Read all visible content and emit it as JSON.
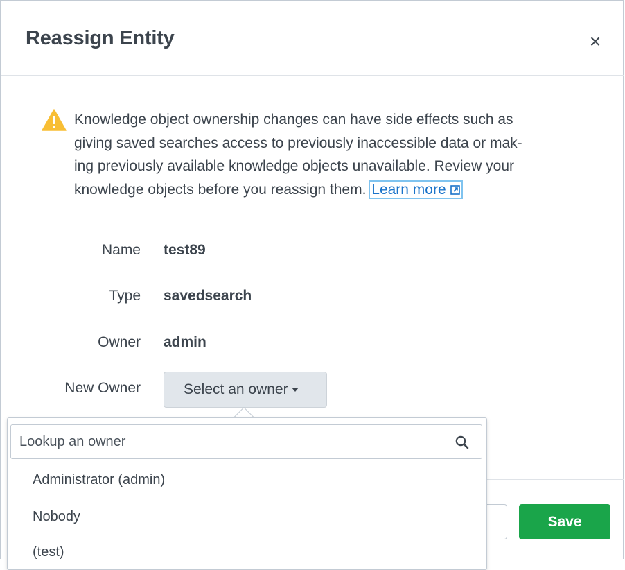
{
  "dialog": {
    "title": "Reassign Entity",
    "close_label": "×"
  },
  "warning": {
    "lines": [
      "Knowledge object ownership changes can have side effects such as",
      "giving saved searches access to previously inaccessible data or mak-",
      "ing previously available knowledge objects unavailable. Review your"
    ],
    "last_line": "knowledge objects before you reassign them.",
    "learn_more": "Learn more",
    "icon": "warning-triangle-icon",
    "icon_color": "#f8be34"
  },
  "fields": {
    "name_label": "Name",
    "name_value": "test89",
    "type_label": "Type",
    "type_value": "savedsearch",
    "owner_label": "Owner",
    "owner_value": "admin",
    "new_owner_label": "New Owner",
    "select_placeholder": "Select an owner"
  },
  "dropdown": {
    "search_placeholder": "Lookup an owner",
    "options": [
      "Administrator (admin)",
      "Nobody",
      "(test)"
    ]
  },
  "footer": {
    "save_label": "Save",
    "save_color": "#1aa54a"
  }
}
